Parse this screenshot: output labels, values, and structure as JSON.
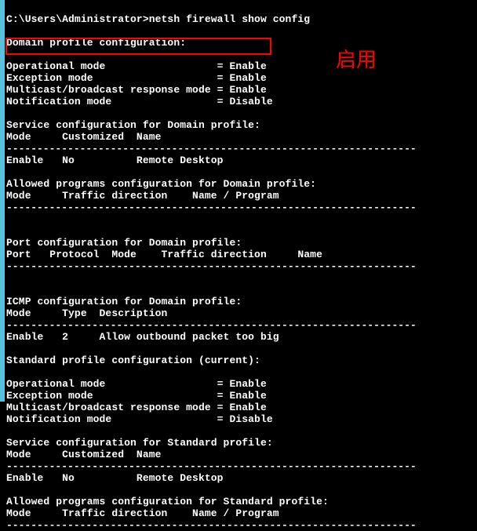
{
  "prompt": "C:\\Users\\Administrator>netsh firewall show config",
  "domain_header": "Domain profile configuration:",
  "domain_modes": {
    "op": "Operational mode                  = Enable",
    "exc": "Exception mode                    = Enable",
    "multi": "Multicast/broadcast response mode = Enable",
    "notif": "Notification mode                 = Disable"
  },
  "service_domain": {
    "title": "Service configuration for Domain profile:",
    "cols": "Mode     Customized  Name",
    "row1": "Enable   No          Remote Desktop"
  },
  "allowed_domain": {
    "title": "Allowed programs configuration for Domain profile:",
    "cols": "Mode     Traffic direction    Name / Program"
  },
  "port_domain": {
    "title": "Port configuration for Domain profile:",
    "cols": "Port   Protocol  Mode    Traffic direction     Name"
  },
  "icmp_domain": {
    "title": "ICMP configuration for Domain profile:",
    "cols": "Mode     Type  Description",
    "row1": "Enable   2     Allow outbound packet too big"
  },
  "standard_header": "Standard profile configuration (current):",
  "standard_modes": {
    "op": "Operational mode                  = Enable",
    "exc": "Exception mode                    = Enable",
    "multi": "Multicast/broadcast response mode = Enable",
    "notif": "Notification mode                 = Disable"
  },
  "service_standard": {
    "title": "Service configuration for Standard profile:",
    "cols": "Mode     Customized  Name",
    "row1": "Enable   No          Remote Desktop"
  },
  "allowed_standard": {
    "title": "Allowed programs configuration for Standard profile:",
    "cols": "Mode     Traffic direction    Name / Program"
  },
  "rule": "-------------------------------------------------------------------",
  "annotation": "启用"
}
